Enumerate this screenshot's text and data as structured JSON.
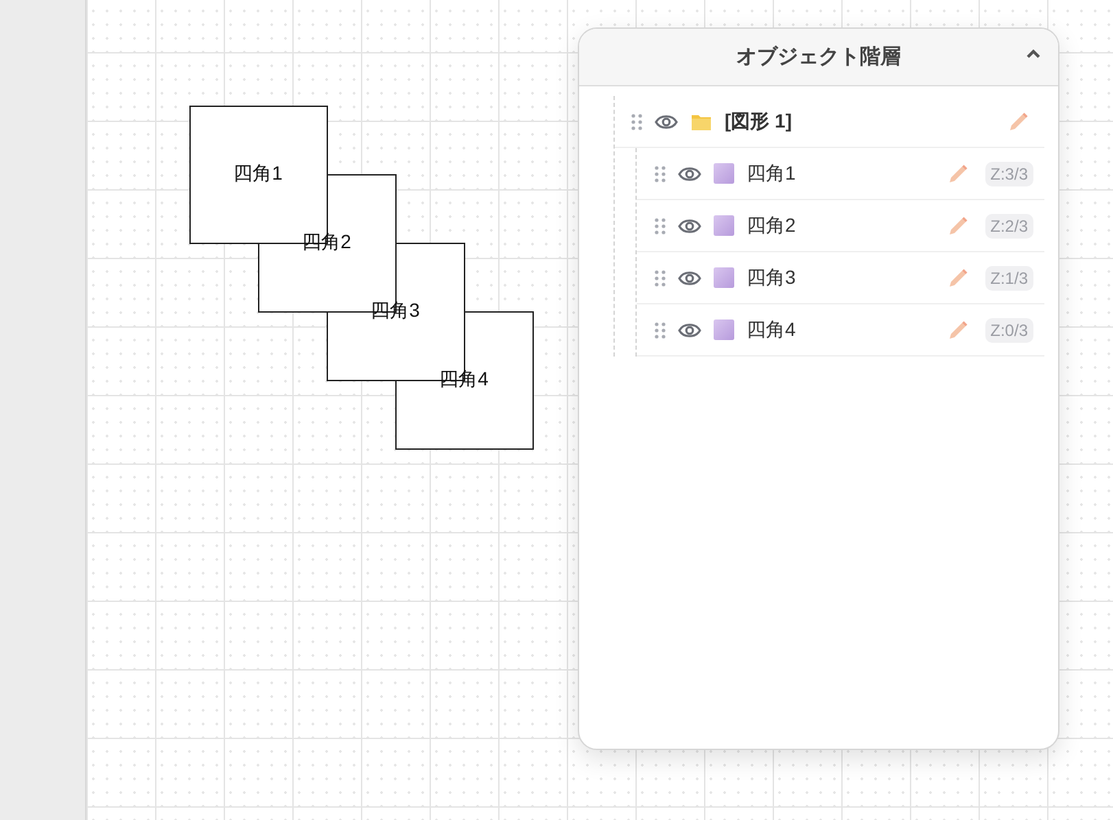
{
  "canvas": {
    "shapes": [
      {
        "label": "四角1"
      },
      {
        "label": "四角2"
      },
      {
        "label": "四角3"
      },
      {
        "label": "四角4"
      }
    ]
  },
  "panel": {
    "title": "オブジェクト階層",
    "expanded": true,
    "tree": [
      {
        "kind": "group",
        "label": "[図形 1]",
        "children": [
          {
            "kind": "rect",
            "label": "四角1",
            "z": "Z:3/3"
          },
          {
            "kind": "rect",
            "label": "四角2",
            "z": "Z:2/3"
          },
          {
            "kind": "rect",
            "label": "四角3",
            "z": "Z:1/3"
          },
          {
            "kind": "rect",
            "label": "四角4",
            "z": "Z:0/3"
          }
        ]
      }
    ]
  }
}
